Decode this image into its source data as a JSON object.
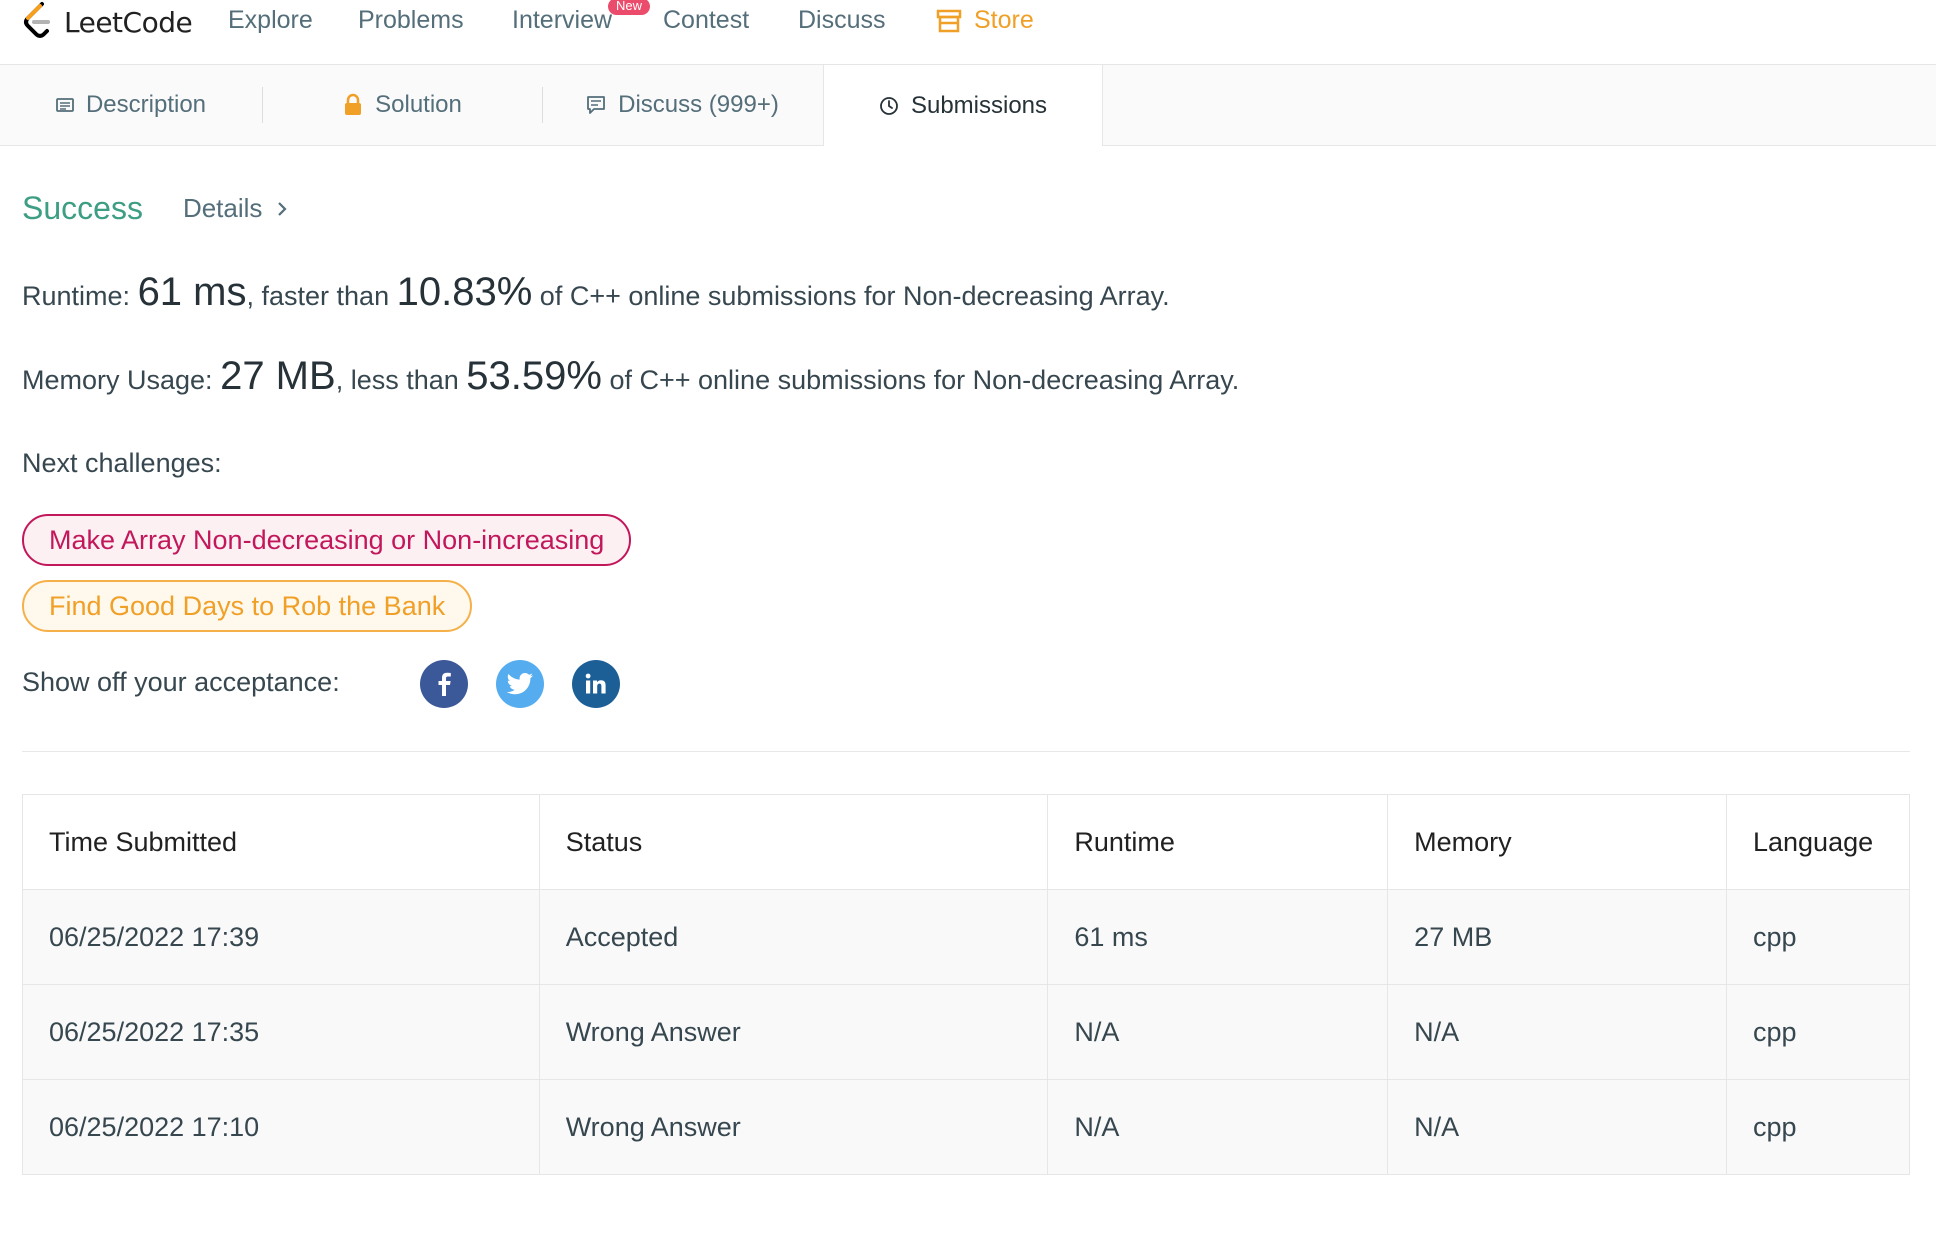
{
  "nav": {
    "brand": "LeetCode",
    "items": [
      {
        "label": "Explore"
      },
      {
        "label": "Problems"
      },
      {
        "label": "Interview",
        "badge": "New"
      },
      {
        "label": "Contest"
      },
      {
        "label": "Discuss"
      }
    ],
    "store_label": "Store",
    "store_color": "#f0a027"
  },
  "tabs": {
    "description": "Description",
    "solution": "Solution",
    "discuss": "Discuss (999+)",
    "submissions": "Submissions",
    "active": "Submissions"
  },
  "result": {
    "status": "Success",
    "details_label": "Details",
    "runtime_prefix": "Runtime:",
    "runtime_value": "61 ms",
    "runtime_mid": ", faster than",
    "runtime_percent": "10.83%",
    "runtime_suffix": "of C++ online submissions for Non-decreasing Array.",
    "memory_prefix": "Memory Usage:",
    "memory_value": "27 MB",
    "memory_mid": ", less than",
    "memory_percent": "53.59%",
    "memory_suffix": "of C++ online submissions for Non-decreasing Array."
  },
  "next_challenges": {
    "label": "Next challenges:",
    "items": [
      {
        "title": "Make Array Non-decreasing or Non-increasing",
        "difficulty_color": "#c2185b"
      },
      {
        "title": "Find Good Days to Rob the Bank",
        "difficulty_color": "#f0a027"
      }
    ]
  },
  "share": {
    "label": "Show off your acceptance:",
    "networks": [
      {
        "icon": "facebook-icon",
        "color": "#3b5998"
      },
      {
        "icon": "twitter-icon",
        "color": "#55acee"
      },
      {
        "icon": "linkedin-icon",
        "color": "#1c5f97"
      }
    ]
  },
  "table": {
    "headers": [
      "Time Submitted",
      "Status",
      "Runtime",
      "Memory",
      "Language"
    ],
    "rows": [
      {
        "time": "06/25/2022 17:39",
        "status": "Accepted",
        "runtime": "61 ms",
        "memory": "27 MB",
        "language": "cpp"
      },
      {
        "time": "06/25/2022 17:35",
        "status": "Wrong Answer",
        "runtime": "N/A",
        "memory": "N/A",
        "language": "cpp"
      },
      {
        "time": "06/25/2022 17:10",
        "status": "Wrong Answer",
        "runtime": "N/A",
        "memory": "N/A",
        "language": "cpp"
      }
    ]
  }
}
